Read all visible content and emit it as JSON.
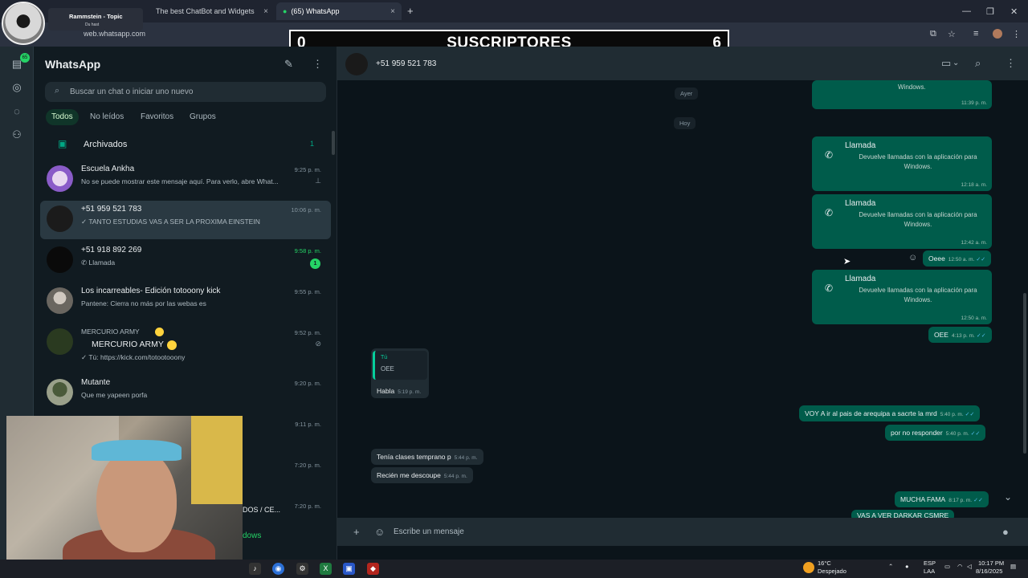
{
  "browser": {
    "tabs": [
      {
        "label": "The best ChatBot and Widgets",
        "close": "×"
      },
      {
        "label": "(65) WhatsApp",
        "close": "×"
      }
    ],
    "new_tab": "+",
    "url": "web.whatsapp.com",
    "window_controls": [
      "—",
      "❐",
      "✕"
    ]
  },
  "stream": {
    "topic_title": "Rammstein - Topic",
    "topic_sub": "Du hast",
    "subs_left": "0",
    "subs_label": "SUSCRIPTORES",
    "subs_right": "6"
  },
  "sidebar": {
    "title": "WhatsApp",
    "search_placeholder": "Buscar un chat o iniciar uno nuevo",
    "filters": [
      "Todos",
      "No leídos",
      "Favoritos",
      "Grupos"
    ],
    "archived_label": "Archivados",
    "archived_count": "1",
    "chats": [
      {
        "name": "Escuela Ankha",
        "time": "9:25 p. m.",
        "preview": "No se puede mostrar este mensaje aquí. Para verlo, abre What..."
      },
      {
        "name": "+51 959 521 783",
        "time": "10:06 p. m.",
        "preview": "✓ TANTO ESTUDIAS VAS A SER LA PROXIMA EINSTEIN"
      },
      {
        "name": "+51 918 892 269",
        "time": "9:58 p. m.",
        "preview": "Llamada",
        "badge": "1"
      },
      {
        "name": "Los incarreables- Edición  totooony kick",
        "time": "9:55 p. m.",
        "preview": "Pantene: Cierra no más por las webas es"
      },
      {
        "name": "MERCURIO ARMY",
        "name2": "MERCURIO ARMY",
        "time": "9:52 p. m.",
        "preview": "✓ Tú: https://kick.com/totootooony"
      },
      {
        "name": "Mutante",
        "time": "9:20 p. m.",
        "preview": "Que me yapeen porfa"
      },
      {
        "name": "",
        "time": "9:11 p. m.",
        "preview": ""
      },
      {
        "name": "",
        "time": "7:20 p. m.",
        "preview": ""
      },
      {
        "name": "",
        "time": "7:20 p. m.",
        "preview": ""
      }
    ],
    "behind_text_1": "DOS / CE...",
    "behind_text_2": "dows"
  },
  "chat": {
    "contact": "+51 959 521 783",
    "date_chips": [
      "Ayer",
      "Hoy"
    ],
    "partial_top": {
      "text": "Windows.",
      "time": "11:39 p. m."
    },
    "calls": [
      {
        "title": "Llamada",
        "desc": "Devuelve llamadas con la aplicación para Windows.",
        "time": "12:18 a. m."
      },
      {
        "title": "Llamada",
        "desc": "Devuelve llamadas con la aplicación para Windows.",
        "time": "12:42 a. m."
      },
      {
        "title": "Llamada",
        "desc": "Devuelve llamadas con la aplicación para Windows.",
        "time": "12:50 a. m."
      }
    ],
    "messages": {
      "oeee": {
        "text": "Oeee",
        "time": "12:50 a. m."
      },
      "oee": {
        "text": "OEE",
        "time": "4:13 p. m."
      },
      "quote_author": "Tú",
      "quote_text": "OEE",
      "habla": {
        "text": "Habla",
        "time": "5:19 p. m."
      },
      "voy": {
        "text": "VOY A ir al pais de arequipa a sacrte la mrd",
        "time": "5:40 p. m."
      },
      "por": {
        "text": "por no responder",
        "time": "5:40 p. m."
      },
      "tenia": {
        "text": "Tenía clases temprano p",
        "time": "5:44 p. m."
      },
      "recien": {
        "text": "Recién me descoupe",
        "time": "5:44 p. m."
      },
      "mucha": {
        "text": "MUCHA FAMA",
        "time": "8:17 p. m."
      },
      "vas": {
        "text": "VAS A VER DARKAR CSMRE"
      }
    },
    "composer_placeholder": "Escribe un mensaje"
  },
  "taskbar": {
    "weather_temp": "16°C",
    "weather_desc": "Despejado",
    "lang_1": "ESP",
    "lang_2": "LAA",
    "clock_time": "10:17 PM",
    "clock_date": "8/16/2025"
  },
  "icons": {
    "search": "⌕",
    "menu": "⋮",
    "new_chat": "✎",
    "archive": "▣",
    "phone": "✆",
    "video": "▶",
    "plus": "+",
    "emoji": "☺",
    "mic": "🎙",
    "pin": "⊥",
    "mute": "🔕",
    "chevron_down": "⌄",
    "check": "✓✓"
  },
  "colors": {
    "accent": "#00a884",
    "outgoing": "#005c4b",
    "incoming": "#202c33",
    "unread": "#25d366"
  }
}
